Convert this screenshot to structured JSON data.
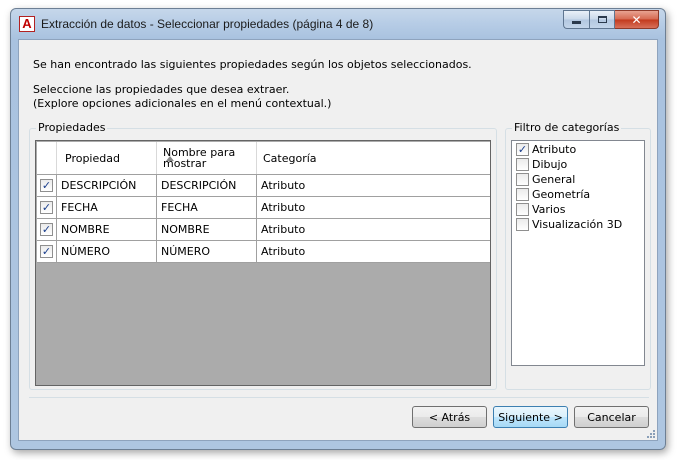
{
  "window": {
    "title": "Extracción de datos - Seleccionar propiedades (página 4 de 8)",
    "app_icon_letter": "A"
  },
  "intro": {
    "line1": "Se han encontrado las siguientes propiedades según los objetos seleccionados.",
    "line2": "Seleccione las propiedades que desea extraer.",
    "line3": "(Explore opciones adicionales en el menú contextual.)"
  },
  "properties_group": {
    "label": "Propiedades",
    "columns": {
      "property": "Propiedad",
      "display_name": "Nombre para mostrar",
      "category": "Categoría"
    },
    "rows": [
      {
        "checked": true,
        "property": "DESCRIPCIÓN",
        "display_name": "DESCRIPCIÓN",
        "category": "Atributo"
      },
      {
        "checked": true,
        "property": "FECHA",
        "display_name": "FECHA",
        "category": "Atributo"
      },
      {
        "checked": true,
        "property": "NOMBRE",
        "display_name": "NOMBRE",
        "category": "Atributo"
      },
      {
        "checked": true,
        "property": "NÚMERO",
        "display_name": "NÚMERO",
        "category": "Atributo"
      }
    ]
  },
  "category_filter": {
    "label": "Filtro de categorías",
    "items": [
      {
        "label": "Atributo",
        "checked": true
      },
      {
        "label": "Dibujo",
        "checked": false
      },
      {
        "label": "General",
        "checked": false
      },
      {
        "label": "Geometría",
        "checked": false
      },
      {
        "label": "Varios",
        "checked": false
      },
      {
        "label": "Visualización 3D",
        "checked": false
      }
    ]
  },
  "buttons": {
    "back": "< Atrás",
    "next": "Siguiente >",
    "cancel": "Cancelar"
  },
  "check_glyph": "✓",
  "colors": {
    "accent": "#3c7fb1",
    "title_bar": "#b7cde6",
    "grid_empty": "#ababab"
  }
}
